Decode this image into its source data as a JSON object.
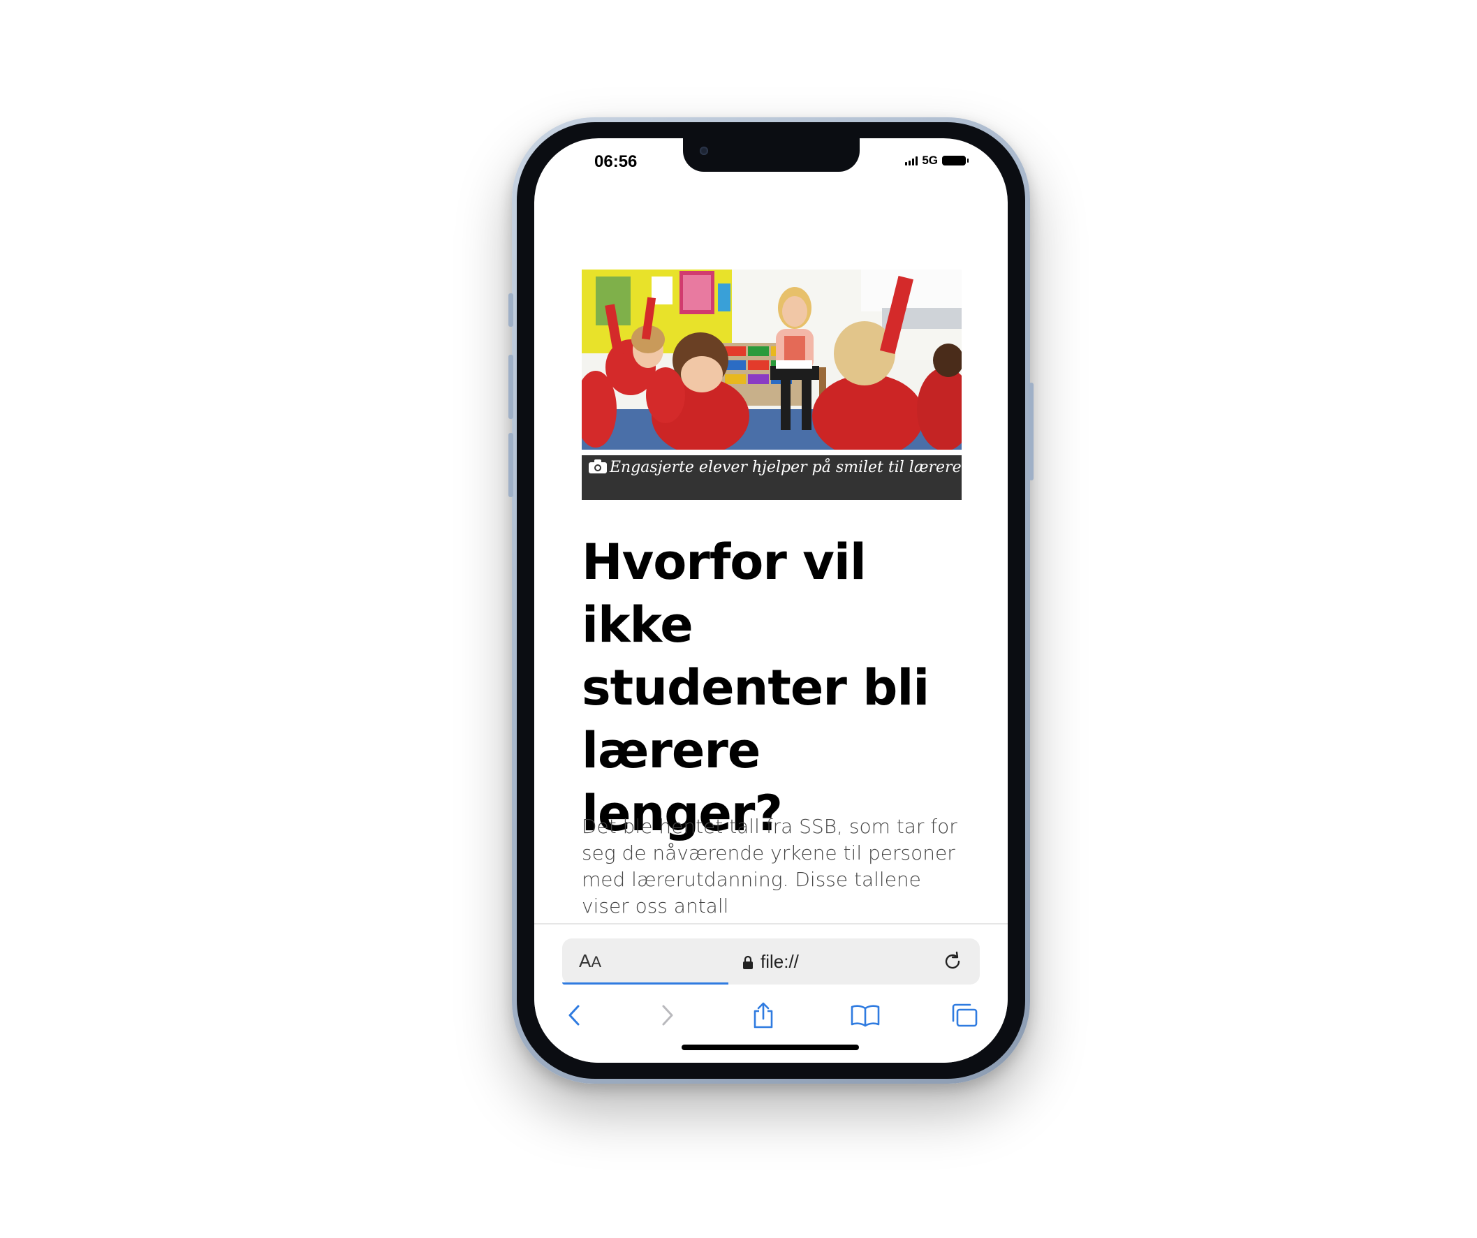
{
  "status_bar": {
    "time": "06:56",
    "network": "5G"
  },
  "article": {
    "image_alt": "Teacher reading to pupils in red school uniforms raising hands",
    "caption": "Engasjerte elever hjelper på smilet til lærere",
    "headline": "Hvorfor vil ikke studenter bli lærere lenger?",
    "body": "Det ble hentet tall fra SSB, som tar for seg de nåværende yrkene til personer med lærerutdanning. Disse tallene viser oss antall"
  },
  "browser": {
    "text_size_label_big": "A",
    "text_size_label_small": "A",
    "url": "file://",
    "icons": {
      "lock": "lock-icon",
      "reload": "reload-icon",
      "back": "chevron-left-icon",
      "forward": "chevron-right-icon",
      "share": "share-icon",
      "bookmarks": "book-icon",
      "tabs": "tabs-icon"
    },
    "accent_color": "#2f7be0"
  },
  "colors": {
    "caption_background": "#333333",
    "headline": "#000000",
    "body": "#444444"
  }
}
